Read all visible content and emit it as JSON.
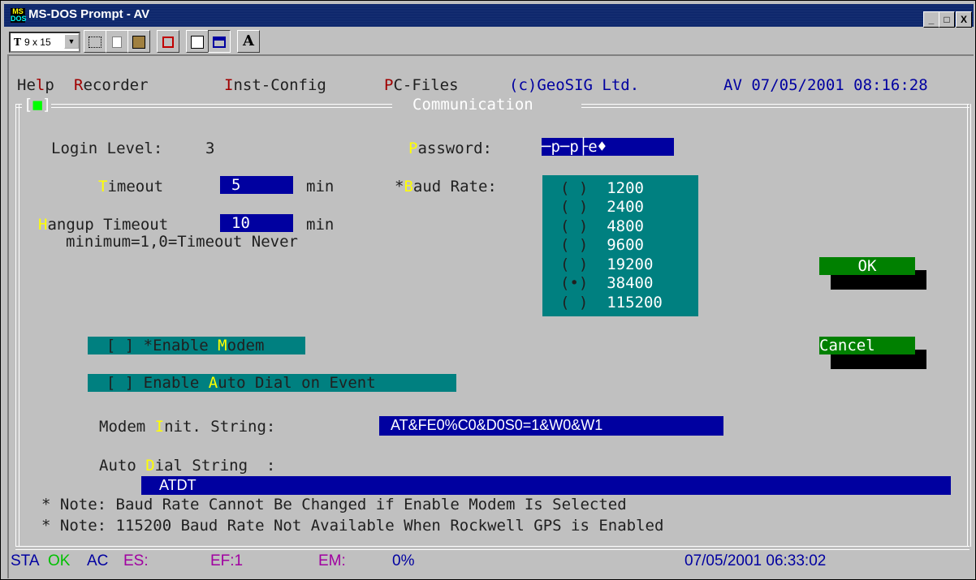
{
  "window": {
    "title": "MS-DOS Prompt - AV",
    "icon_text": "MS\nDOS",
    "minimize_glyph": "_",
    "maximize_glyph": "□",
    "close_glyph": "X"
  },
  "toolbar": {
    "font_size": "9 x 15",
    "bold_font_glyph": "A"
  },
  "menu": {
    "items": [
      {
        "pre": "He",
        "hk": "l",
        "post": "p"
      },
      {
        "pre": "",
        "hk": "R",
        "post": "ecorder"
      },
      {
        "pre": "",
        "hk": "I",
        "post": "nst-Config"
      },
      {
        "pre": "",
        "hk": "P",
        "post": "C-Files"
      }
    ],
    "company": "(c)GeoSIG Ltd.",
    "datetime": "AV 07/05/2001 08:16:28"
  },
  "dialog": {
    "title": "Communication",
    "close_box": "[■]",
    "login_label": "Login Level:",
    "login_value": "3",
    "password_label_hk": "P",
    "password_label_rest": "assword:",
    "password_value": "─p─p├e♦",
    "timeout_hk": "T",
    "timeout_rest": "imeout",
    "timeout_value": "5",
    "timeout_unit": "min",
    "hangup_hk": "H",
    "hangup_rest": "angup Timeout",
    "hangup_value": "10",
    "hangup_unit": "min",
    "hangup_note": "minimum=1,0=Timeout Never",
    "baud_star": "*",
    "baud_hk": "B",
    "baud_rest": "aud Rate:",
    "baud_options": [
      {
        "mark": "( )",
        "value": "1200"
      },
      {
        "mark": "( )",
        "value": "2400"
      },
      {
        "mark": "( )",
        "value": "4800"
      },
      {
        "mark": "( )",
        "value": "9600"
      },
      {
        "mark": "( )",
        "value": "19200"
      },
      {
        "mark": "(•)",
        "value": "38400"
      },
      {
        "mark": "( )",
        "value": "115200"
      }
    ],
    "ok_label": "OK",
    "cancel_label": "Cancel",
    "enable_modem_pre": "[ ] *Enable ",
    "enable_modem_hk": "M",
    "enable_modem_post": "odem",
    "auto_dial_pre": "[ ] Enable ",
    "auto_dial_hk": "A",
    "auto_dial_post": "uto Dial on Event",
    "init_pre": "Modem ",
    "init_hk": "I",
    "init_post": "nit. String:",
    "init_value": "AT&FE0%C0&D0S0=1&W0&W1",
    "dial_pre": "Auto ",
    "dial_hk": "D",
    "dial_post": "ial String  :",
    "dial_value": "ATDT",
    "note1": "* Note: Baud Rate Cannot Be Changed if Enable Modem Is Selected",
    "note2": "* Note: 115200 Baud Rate Not Available When Rockwell GPS is Enabled"
  },
  "statusbar": {
    "sta": "STA",
    "ok": "OK",
    "ac": "AC",
    "es": "ES:",
    "ef": "EF:1",
    "em": "EM:",
    "pct": "0%",
    "datetime": "07/05/2001 06:33:02"
  },
  "colors": {
    "title_bar": "#0a246a",
    "field_blue": "#0000a0",
    "teal": "#008080",
    "button_green": "#008000",
    "hotkey_yellow": "#ffff00",
    "menu_red": "#a00000"
  }
}
